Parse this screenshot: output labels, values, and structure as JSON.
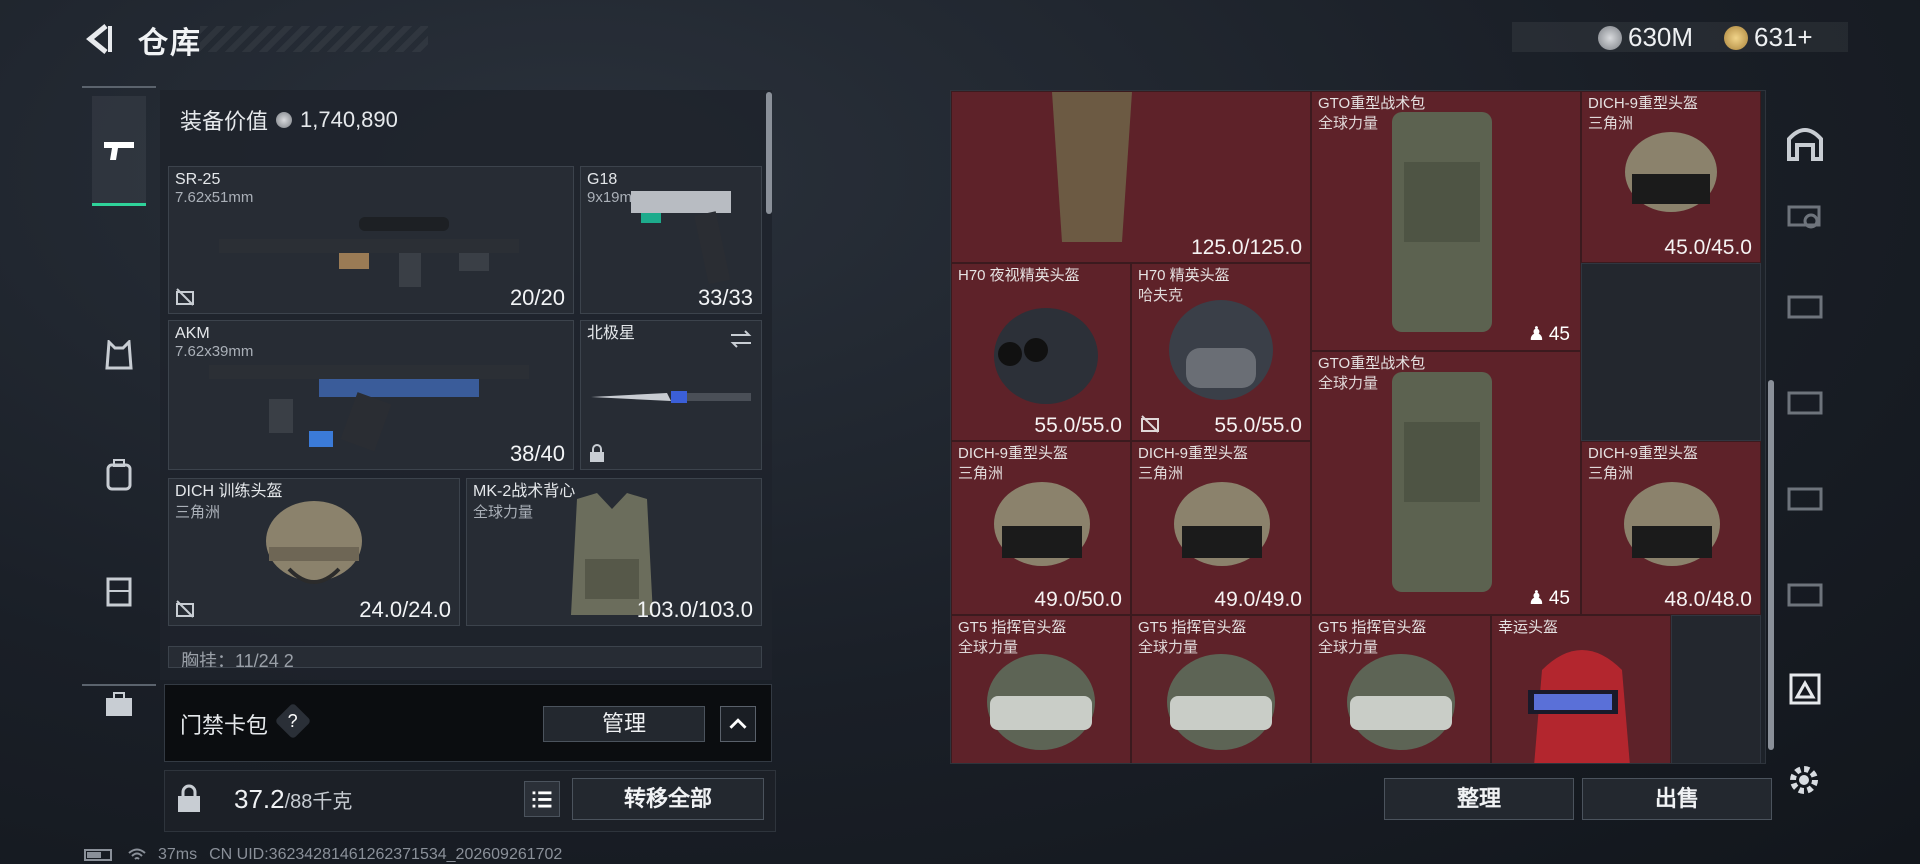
{
  "header": {
    "title": "仓库",
    "currency1": "630M",
    "currency2": "631+"
  },
  "left": {
    "equip_value_label": "装备价值",
    "equip_value": "1,740,890",
    "slots": [
      {
        "name": "SR-25",
        "sub": "7.62x51mm",
        "value": "20/20"
      },
      {
        "name": "G18",
        "sub": "9x19mm",
        "value": "33/33"
      },
      {
        "name": "AKM",
        "sub": "7.62x39mm",
        "value": "38/40"
      },
      {
        "name": "北极星",
        "sub": "",
        "value": ""
      },
      {
        "name": "DICH 训练头盔",
        "sub": "三角洲",
        "value": "24.0/24.0"
      },
      {
        "name": "MK-2战术背心",
        "sub": "全球力量",
        "value": "103.0/103.0"
      }
    ],
    "chest_rig_partial": "胸挂：11/24  2",
    "card_label": "门禁卡包",
    "manage_label": "管理",
    "weight": "37.2",
    "weight_max": "/88千克",
    "transfer_all": "转移全部"
  },
  "status": {
    "ping": "37ms",
    "uid": "CN UID:3623428146126237153​4_202609261702"
  },
  "stash": {
    "items": [
      {
        "name": "",
        "sub": "",
        "value": "125.0/125.0"
      },
      {
        "name": "GTO重型战术包",
        "sub": "全球力量",
        "count": "45"
      },
      {
        "name": "DICH-9重型头盔",
        "sub": "三角洲",
        "value": "45.0/45.0"
      },
      {
        "name": "H70 夜视精英头盔",
        "sub": "",
        "value": "55.0/55.0"
      },
      {
        "name": "H70 精英头盔",
        "sub": "哈夫克",
        "value": "55.0/55.0"
      },
      {
        "name": "GTO重型战术包",
        "sub": "全球力量",
        "count": "45"
      },
      {
        "name": "DICH-9重型头盔",
        "sub": "三角洲",
        "value": "49.0/50.0"
      },
      {
        "name": "DICH-9重型头盔",
        "sub": "三角洲",
        "value": "49.0/49.0"
      },
      {
        "name": "DICH-9重型头盔",
        "sub": "三角洲",
        "value": "48.0/48.0"
      },
      {
        "name": "GT5 指挥官头盔",
        "sub": "全球力量",
        "value": ""
      },
      {
        "name": "GT5 指挥官头盔",
        "sub": "全球力量",
        "value": ""
      },
      {
        "name": "GT5 指挥官头盔",
        "sub": "全球力量",
        "value": ""
      },
      {
        "name": "幸运头盔",
        "sub": "",
        "value": ""
      }
    ],
    "sort_label": "整理",
    "sell_label": "出售"
  },
  "colors": {
    "accent": "#2fd39a",
    "cell_red": "#5e2229"
  }
}
